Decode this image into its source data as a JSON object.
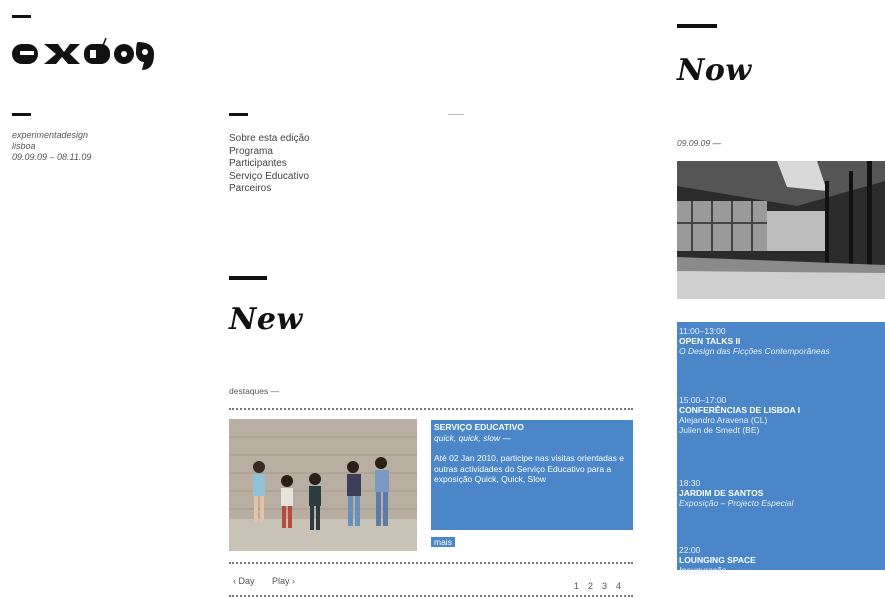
{
  "brand": {
    "logo_text": "EXD09",
    "tagline_lines": [
      "experimentadesign",
      "lisboa",
      "09.09.09 – 08.11.09"
    ]
  },
  "nav": {
    "items": [
      "Sobre esta edição",
      "Programa",
      "Participantes",
      "Serviço Educativo",
      "Parceiros"
    ]
  },
  "new_section": {
    "title": "New",
    "label": "destaques —",
    "feature": {
      "category": "SERVIÇO EDUCATIVO",
      "subtitle": "quick, quick, slow —",
      "body": "Até 02 Jan 2010, participe nas visitas orientadas e outras actividades do Serviço Educativo para a exposição Quick, Quick, Slow",
      "more": "mais"
    },
    "pager": {
      "prev": "‹ Day",
      "next": "Play ›",
      "pages": [
        "1",
        "2",
        "3",
        "4"
      ]
    }
  },
  "now_section": {
    "title": "Now",
    "date": "09.09.09 —",
    "events": [
      {
        "time": "11:00–13:00",
        "title": "OPEN TALKS II",
        "lines": [
          "O Design das Ficções Contemporâneas"
        ]
      },
      {
        "time": "15:00–17:00",
        "title": "CONFERÊNCIAS DE LISBOA I",
        "lines": [
          "Alejandro Aravena (CL)",
          "Julien de Smedt (BE)"
        ]
      },
      {
        "time": "18:30",
        "title": "JARDIM DE SANTOS",
        "lines": [
          "Exposição – Projecto Especial"
        ]
      },
      {
        "time": "22:00",
        "title": "LOUNGING SPACE",
        "lines": [
          "Inauguração"
        ]
      }
    ]
  },
  "colors": {
    "accent": "#4a86c8",
    "ink": "#111111"
  }
}
